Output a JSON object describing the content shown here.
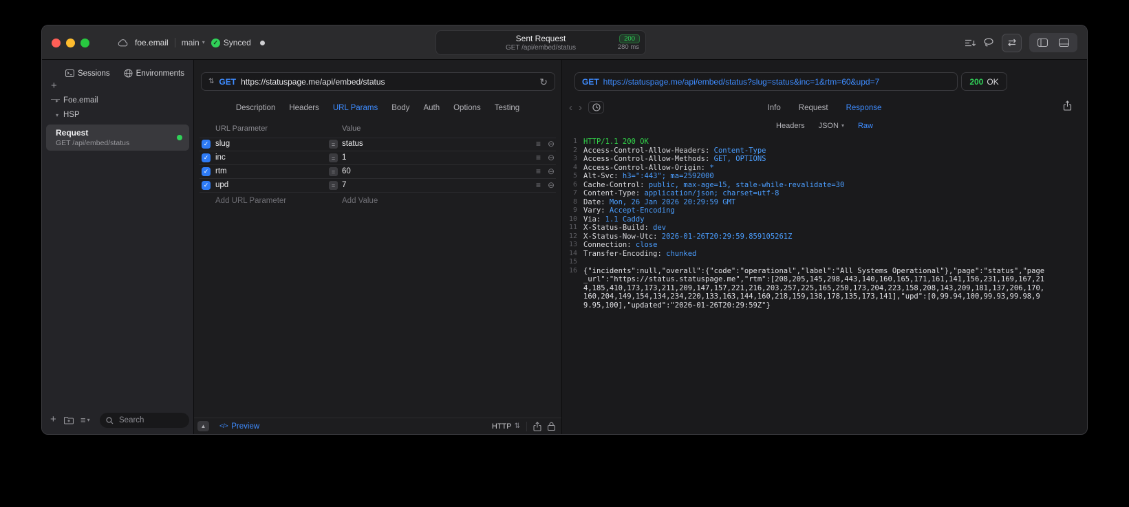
{
  "icons": {
    "check": "✓",
    "equals": "=",
    "menu_rows": "≡",
    "remove_circle": "⊖",
    "chevron_right": "▸",
    "chevron_down": "▾",
    "method_stepper": "⇅",
    "refresh": "↻",
    "back": "‹",
    "forward": "›",
    "panel_up": "▲",
    "code": "</>",
    "plus": "+",
    "minus": "—"
  },
  "titlebar": {
    "project": "foe.email",
    "branch": "main",
    "sync_label": "Synced",
    "request_summary": {
      "title": "Sent Request",
      "status_code": "200",
      "method_path": "GET /api/embed/status",
      "duration": "280 ms"
    }
  },
  "sidebar": {
    "tab_sessions": "Sessions",
    "tab_environments": "Environments",
    "group_foe": "Foe.email",
    "group_hsp": "HSP",
    "request_item": {
      "title": "Request",
      "subtitle": "GET /api/embed/status"
    },
    "search_placeholder": "Search"
  },
  "request_pane": {
    "method": "GET",
    "url": "https://statuspage.me/api/embed/status",
    "tabs": [
      "Description",
      "Headers",
      "URL Params",
      "Body",
      "Auth",
      "Options",
      "Testing"
    ],
    "active_tab": "URL Params",
    "params": {
      "col_parameter": "URL Parameter",
      "col_value": "Value",
      "rows": [
        {
          "key": "slug",
          "value": "status"
        },
        {
          "key": "inc",
          "value": "1"
        },
        {
          "key": "rtm",
          "value": "60"
        },
        {
          "key": "upd",
          "value": "7"
        }
      ],
      "add_parameter": "Add URL Parameter",
      "add_value": "Add Value"
    },
    "footer": {
      "preview": "Preview",
      "protocol": "HTTP"
    }
  },
  "response_pane": {
    "method": "GET",
    "url": "https://statuspage.me/api/embed/status?slug=status&inc=1&rtm=60&upd=7",
    "status_code": "200",
    "status_text": "OK",
    "tabs": [
      "Info",
      "Request",
      "Response"
    ],
    "active_tab": "Response",
    "subtabs": [
      "Headers",
      "JSON",
      "Raw"
    ],
    "active_subtab": "Raw",
    "lines": [
      {
        "num": "1",
        "text": "HTTP/1.1 200 OK"
      },
      {
        "num": "2",
        "name": "Access-Control-Allow-Headers:",
        "value": " Content-Type"
      },
      {
        "num": "3",
        "name": "Access-Control-Allow-Methods:",
        "value": " GET, OPTIONS"
      },
      {
        "num": "4",
        "name": "Access-Control-Allow-Origin:",
        "value": " *"
      },
      {
        "num": "5",
        "name": "Alt-Svc:",
        "value": " h3=\":443\"; ma=2592000"
      },
      {
        "num": "6",
        "name": "Cache-Control:",
        "value": " public, max-age=15, stale-while-revalidate=30"
      },
      {
        "num": "7",
        "name": "Content-Type:",
        "value": " application/json; charset=utf-8"
      },
      {
        "num": "8",
        "name": "Date:",
        "value": " Mon, 26 Jan 2026 20:29:59 GMT"
      },
      {
        "num": "9",
        "name": "Vary:",
        "value": " Accept-Encoding"
      },
      {
        "num": "10",
        "name": "Via:",
        "value": " 1.1 Caddy"
      },
      {
        "num": "11",
        "name": "X-Status-Build:",
        "value": " dev"
      },
      {
        "num": "12",
        "name": "X-Status-Now-Utc:",
        "value": " 2026-01-26T20:29:59.859105261Z"
      },
      {
        "num": "13",
        "name": "Connection:",
        "value": " close"
      },
      {
        "num": "14",
        "name": "Transfer-Encoding:",
        "value": " chunked"
      },
      {
        "num": "15"
      },
      {
        "num": "16",
        "text": "{\"incidents\":null,\"overall\":{\"code\":\"operational\",\"label\":\"All Systems Operational\"},\"page\":\"status\",\"page_url\":\"https://status.statuspage.me\",\"rtm\":[208,205,145,298,443,140,160,165,171,161,141,156,231,169,167,214,185,410,173,173,211,209,147,157,221,216,203,257,225,165,250,173,204,223,158,208,143,209,181,137,206,170,160,204,149,154,134,234,220,133,163,144,160,218,159,138,178,135,173,141],\"upd\":[0,99.94,100,99.93,99.98,99.95,100],\"updated\":\"2026-01-26T20:29:59Z\"}"
      }
    ]
  }
}
